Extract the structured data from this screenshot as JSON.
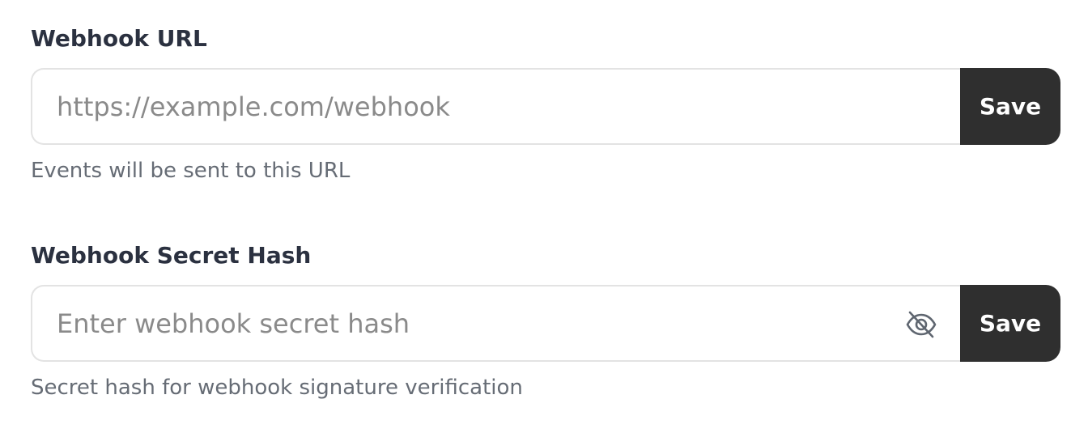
{
  "webhook_url": {
    "label": "Webhook URL",
    "value": "",
    "placeholder": "https://example.com/webhook",
    "save_label": "Save",
    "help_text": "Events will be sent to this URL"
  },
  "webhook_secret": {
    "label": "Webhook Secret Hash",
    "value": "",
    "placeholder": "Enter webhook secret hash",
    "visibility_icon": "eye-off-icon",
    "save_label": "Save",
    "help_text": "Secret hash for webhook signature verification"
  },
  "colors": {
    "button_bg": "#2f2f2f",
    "label_text": "#2b3140",
    "help_text": "#666c75",
    "input_border": "#e3e3e3"
  }
}
